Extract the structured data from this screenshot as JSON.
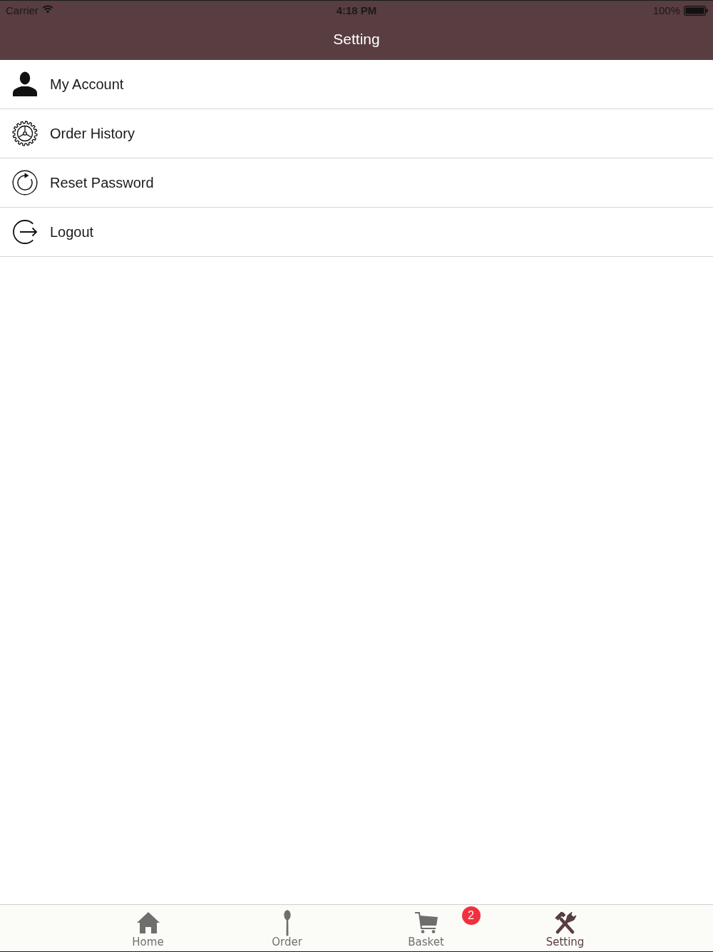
{
  "status_bar": {
    "carrier": "Carrier",
    "time": "4:18 PM",
    "battery": "100%"
  },
  "nav_bar": {
    "title": "Setting"
  },
  "menu": [
    {
      "kind": "account",
      "label": "My Account"
    },
    {
      "kind": "history",
      "label": "Order History"
    },
    {
      "kind": "reset",
      "label": "Reset Password"
    },
    {
      "kind": "logout",
      "label": "Logout"
    }
  ],
  "tab_bar": [
    {
      "kind": "home",
      "label": "Home",
      "selected": false
    },
    {
      "kind": "order",
      "label": "Order",
      "selected": false
    },
    {
      "kind": "basket",
      "label": "Basket",
      "selected": false,
      "badge": "2"
    },
    {
      "kind": "setting",
      "label": "Setting",
      "selected": true
    }
  ]
}
